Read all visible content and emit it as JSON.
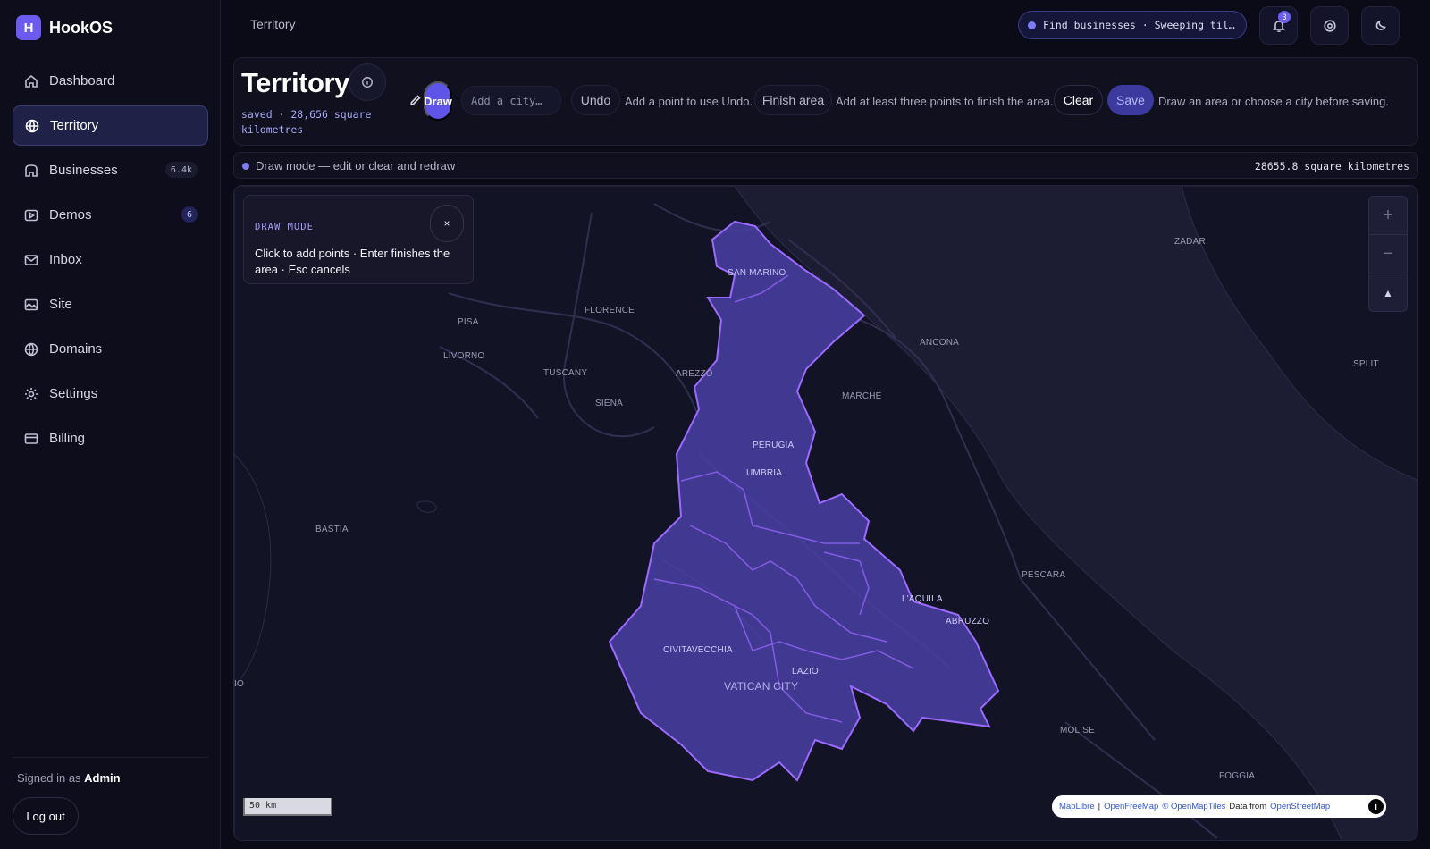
{
  "brand": {
    "logo_letter": "H",
    "name": "HookOS"
  },
  "sidebar": {
    "items": [
      {
        "label": "Dashboard",
        "icon": "home-icon",
        "badge": ""
      },
      {
        "label": "Territory",
        "icon": "globe-icon",
        "badge": "",
        "active": true
      },
      {
        "label": "Businesses",
        "icon": "store-icon",
        "badge": "6.4k"
      },
      {
        "label": "Demos",
        "icon": "play-icon",
        "badge": "6"
      },
      {
        "label": "Inbox",
        "icon": "mail-icon",
        "badge": ""
      },
      {
        "label": "Site",
        "icon": "image-icon",
        "badge": ""
      },
      {
        "label": "Domains",
        "icon": "globe-icon",
        "badge": ""
      },
      {
        "label": "Settings",
        "icon": "gear-icon",
        "badge": ""
      },
      {
        "label": "Billing",
        "icon": "card-icon",
        "badge": ""
      }
    ],
    "signed_in_prefix": "Signed in as ",
    "signed_in_user": "Admin",
    "logout_label": "Log out"
  },
  "topbar": {
    "breadcrumb": "Territory",
    "task_text": "Find businesses · Sweeping til…",
    "notification_count": "3"
  },
  "header": {
    "title": "Territory",
    "saved_text": "saved · 28,656 square kilometres",
    "draw_label": "Draw",
    "city_placeholder": "Add a city…",
    "undo_label": "Undo",
    "undo_hint": "Add a point to use Undo.",
    "finish_label": "Finish area",
    "finish_hint": "Add at least three points to finish the area.",
    "clear_label": "Clear",
    "save_label": "Save",
    "save_hint": "Draw an area or choose a city before saving."
  },
  "status": {
    "text": "Draw mode — edit or clear and redraw",
    "area": "28655.8 square kilometres"
  },
  "map": {
    "draw_card_title": "DRAW MODE",
    "draw_card_body": "Click to add points · Enter finishes the area · Esc cancels",
    "close_symbol": "×",
    "zoom_in": "+",
    "zoom_out": "−",
    "compass": "▲",
    "scale": "50 km",
    "labels": {
      "zadar": "ZADAR",
      "san_marino": "SAN MARINO",
      "florence": "FLORENCE",
      "pisa": "PISA",
      "ancona": "ANCONA",
      "livorno": "LIVORNO",
      "tuscany": "TUSCANY",
      "arezzo": "AREZZO",
      "split": "SPLIT",
      "marche": "MARCHE",
      "siena": "SIENA",
      "perugia": "PERUGIA",
      "umbria": "UMBRIA",
      "bastia": "BASTIA",
      "pescara": "PESCARA",
      "laquila": "L'AQUILA",
      "abruzzo": "ABRUZZO",
      "civitavecchia": "CIVITAVECCHIA",
      "lazio": "LAZIO",
      "vatican": "VATICAN CITY",
      "io": "IO",
      "molise": "MOLISE",
      "foggia": "FOGGIA"
    },
    "attribution": {
      "maplibre": "MapLibre",
      "sep": "|",
      "openfreemap": "OpenFreeMap",
      "openmaptiles": "© OpenMapTiles",
      "data_from": "Data from",
      "osm": "OpenStreetMap",
      "info": "i"
    }
  },
  "colors": {
    "accent": "#5e55e8",
    "territory_fill": "#4b3fa6",
    "territory_stroke": "#9a6cff"
  }
}
